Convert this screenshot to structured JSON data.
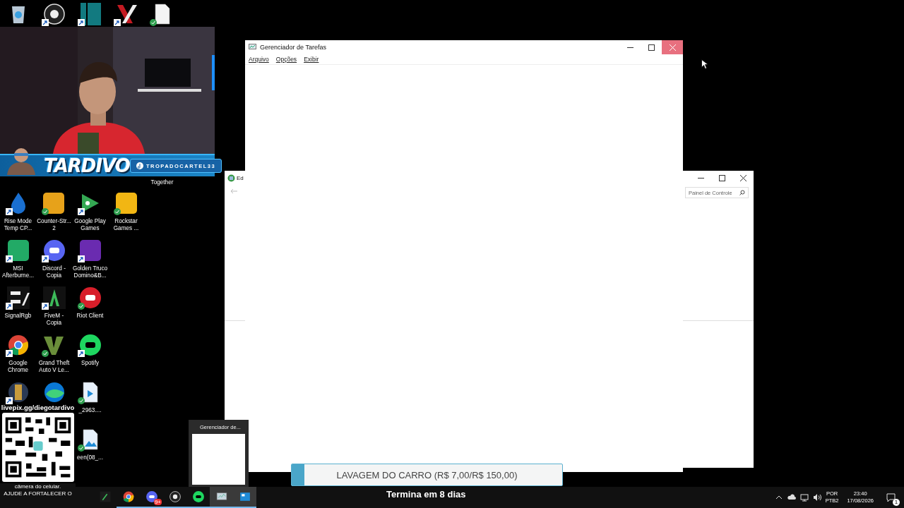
{
  "desktop": {
    "top_row": [
      {
        "kind": "trash",
        "shortcut": false,
        "synced": false
      },
      {
        "kind": "ring",
        "shortcut": true,
        "synced": false
      },
      {
        "kind": "panel",
        "shortcut": true,
        "synced": false
      },
      {
        "kind": "cross",
        "shortcut": true,
        "synced": false
      },
      {
        "kind": "document",
        "shortcut": false,
        "synced": true
      }
    ],
    "cut_label": "Together",
    "rows": [
      [
        {
          "kind": "flame",
          "label_lines": [
            "Rise Mode",
            "Temp CP..."
          ],
          "shortcut": true,
          "synced": false
        },
        {
          "kind": "soldier",
          "label_lines": [
            "Counter-Str...",
            "2"
          ],
          "shortcut": false,
          "synced": true
        },
        {
          "kind": "play",
          "label_lines": [
            "Google Play",
            "Games"
          ],
          "shortcut": true,
          "synced": false
        },
        {
          "kind": "star",
          "label_lines": [
            "Rockstar",
            "Games ..."
          ],
          "shortcut": false,
          "synced": true
        }
      ],
      [
        {
          "kind": "disc",
          "label_lines": [
            "MSI",
            "Afterburne..."
          ],
          "shortcut": true,
          "synced": false
        },
        {
          "kind": "chat",
          "label_lines": [
            "Discord -",
            "Copia"
          ],
          "shortcut": true,
          "synced": false
        },
        {
          "kind": "cards",
          "label_lines": [
            "Golden Truco",
            "Domino&B..."
          ],
          "shortcut": true,
          "synced": false
        }
      ],
      [
        {
          "kind": "stripes",
          "label_lines": [
            "SignalRgb"
          ],
          "shortcut": true,
          "synced": false
        },
        {
          "kind": "peak",
          "label_lines": [
            "FiveM -",
            "Copia"
          ],
          "shortcut": true,
          "synced": false
        },
        {
          "kind": "fist",
          "label_lines": [
            "Riot Client"
          ],
          "shortcut": false,
          "synced": true
        }
      ],
      [
        {
          "kind": "browser",
          "label_lines": [
            "Google",
            "Chrome"
          ],
          "shortcut": true,
          "synced": false
        },
        {
          "kind": "vee",
          "label_lines": [
            "Grand Theft",
            "Auto V Le..."
          ],
          "shortcut": false,
          "synced": true
        },
        {
          "kind": "music",
          "label_lines": [
            "Spotify"
          ],
          "shortcut": true,
          "synced": false
        }
      ],
      [
        {
          "kind": "shield",
          "shortcut": true,
          "synced": false
        },
        {
          "kind": "wave",
          "shortcut": false,
          "synced": false
        },
        {
          "kind": "video",
          "label_lines": [
            "_2963...."
          ],
          "shortcut": false,
          "synced": true
        }
      ],
      [
        null,
        null,
        {
          "label_lines": [
            "een(08_..."
          ],
          "shortcut": false,
          "synced": true
        }
      ]
    ]
  },
  "stream_overlay": {
    "name": "TARDIVO",
    "handle": "TROPADOCARTEL33"
  },
  "qr_panel": {
    "url": "livepix.gg/diegotardivo",
    "caption_lines": [
      "câmera do celular.",
      "AJUDE A FORTALECER O"
    ]
  },
  "control_panel": {
    "title": "Ed",
    "search_placeholder": "Painel de Controle"
  },
  "task_manager": {
    "title": "Gerenciador de Tarefas",
    "menu": [
      "Arquivo",
      "Opções",
      "Exibir"
    ],
    "close_hovered": true
  },
  "thumbnail": {
    "title": "Gerenciador de..."
  },
  "goal": {
    "title": "LAVAGEM DO CARRO (R$ 7,00/R$ 150,00)",
    "level": 0.047,
    "ends": "Termina em 8 dias"
  },
  "taskbar": {
    "apps": [
      {
        "kind": "tool",
        "running": false,
        "highlighted": false
      },
      {
        "kind": "browser",
        "running": true,
        "highlighted": false
      },
      {
        "kind": "chat",
        "running": true,
        "highlighted": false,
        "badge": "9+"
      },
      {
        "kind": "ring",
        "running": true,
        "highlighted": false
      },
      {
        "kind": "music",
        "running": true,
        "highlighted": false
      },
      {
        "kind": "monitor",
        "running": true,
        "highlighted": true
      },
      {
        "kind": "panel2",
        "running": true,
        "highlighted": true
      }
    ],
    "tray": {
      "language": "POR",
      "layout": "PTB2",
      "time": "23:40",
      "date": "17/08/2026",
      "notifications": "1"
    }
  }
}
